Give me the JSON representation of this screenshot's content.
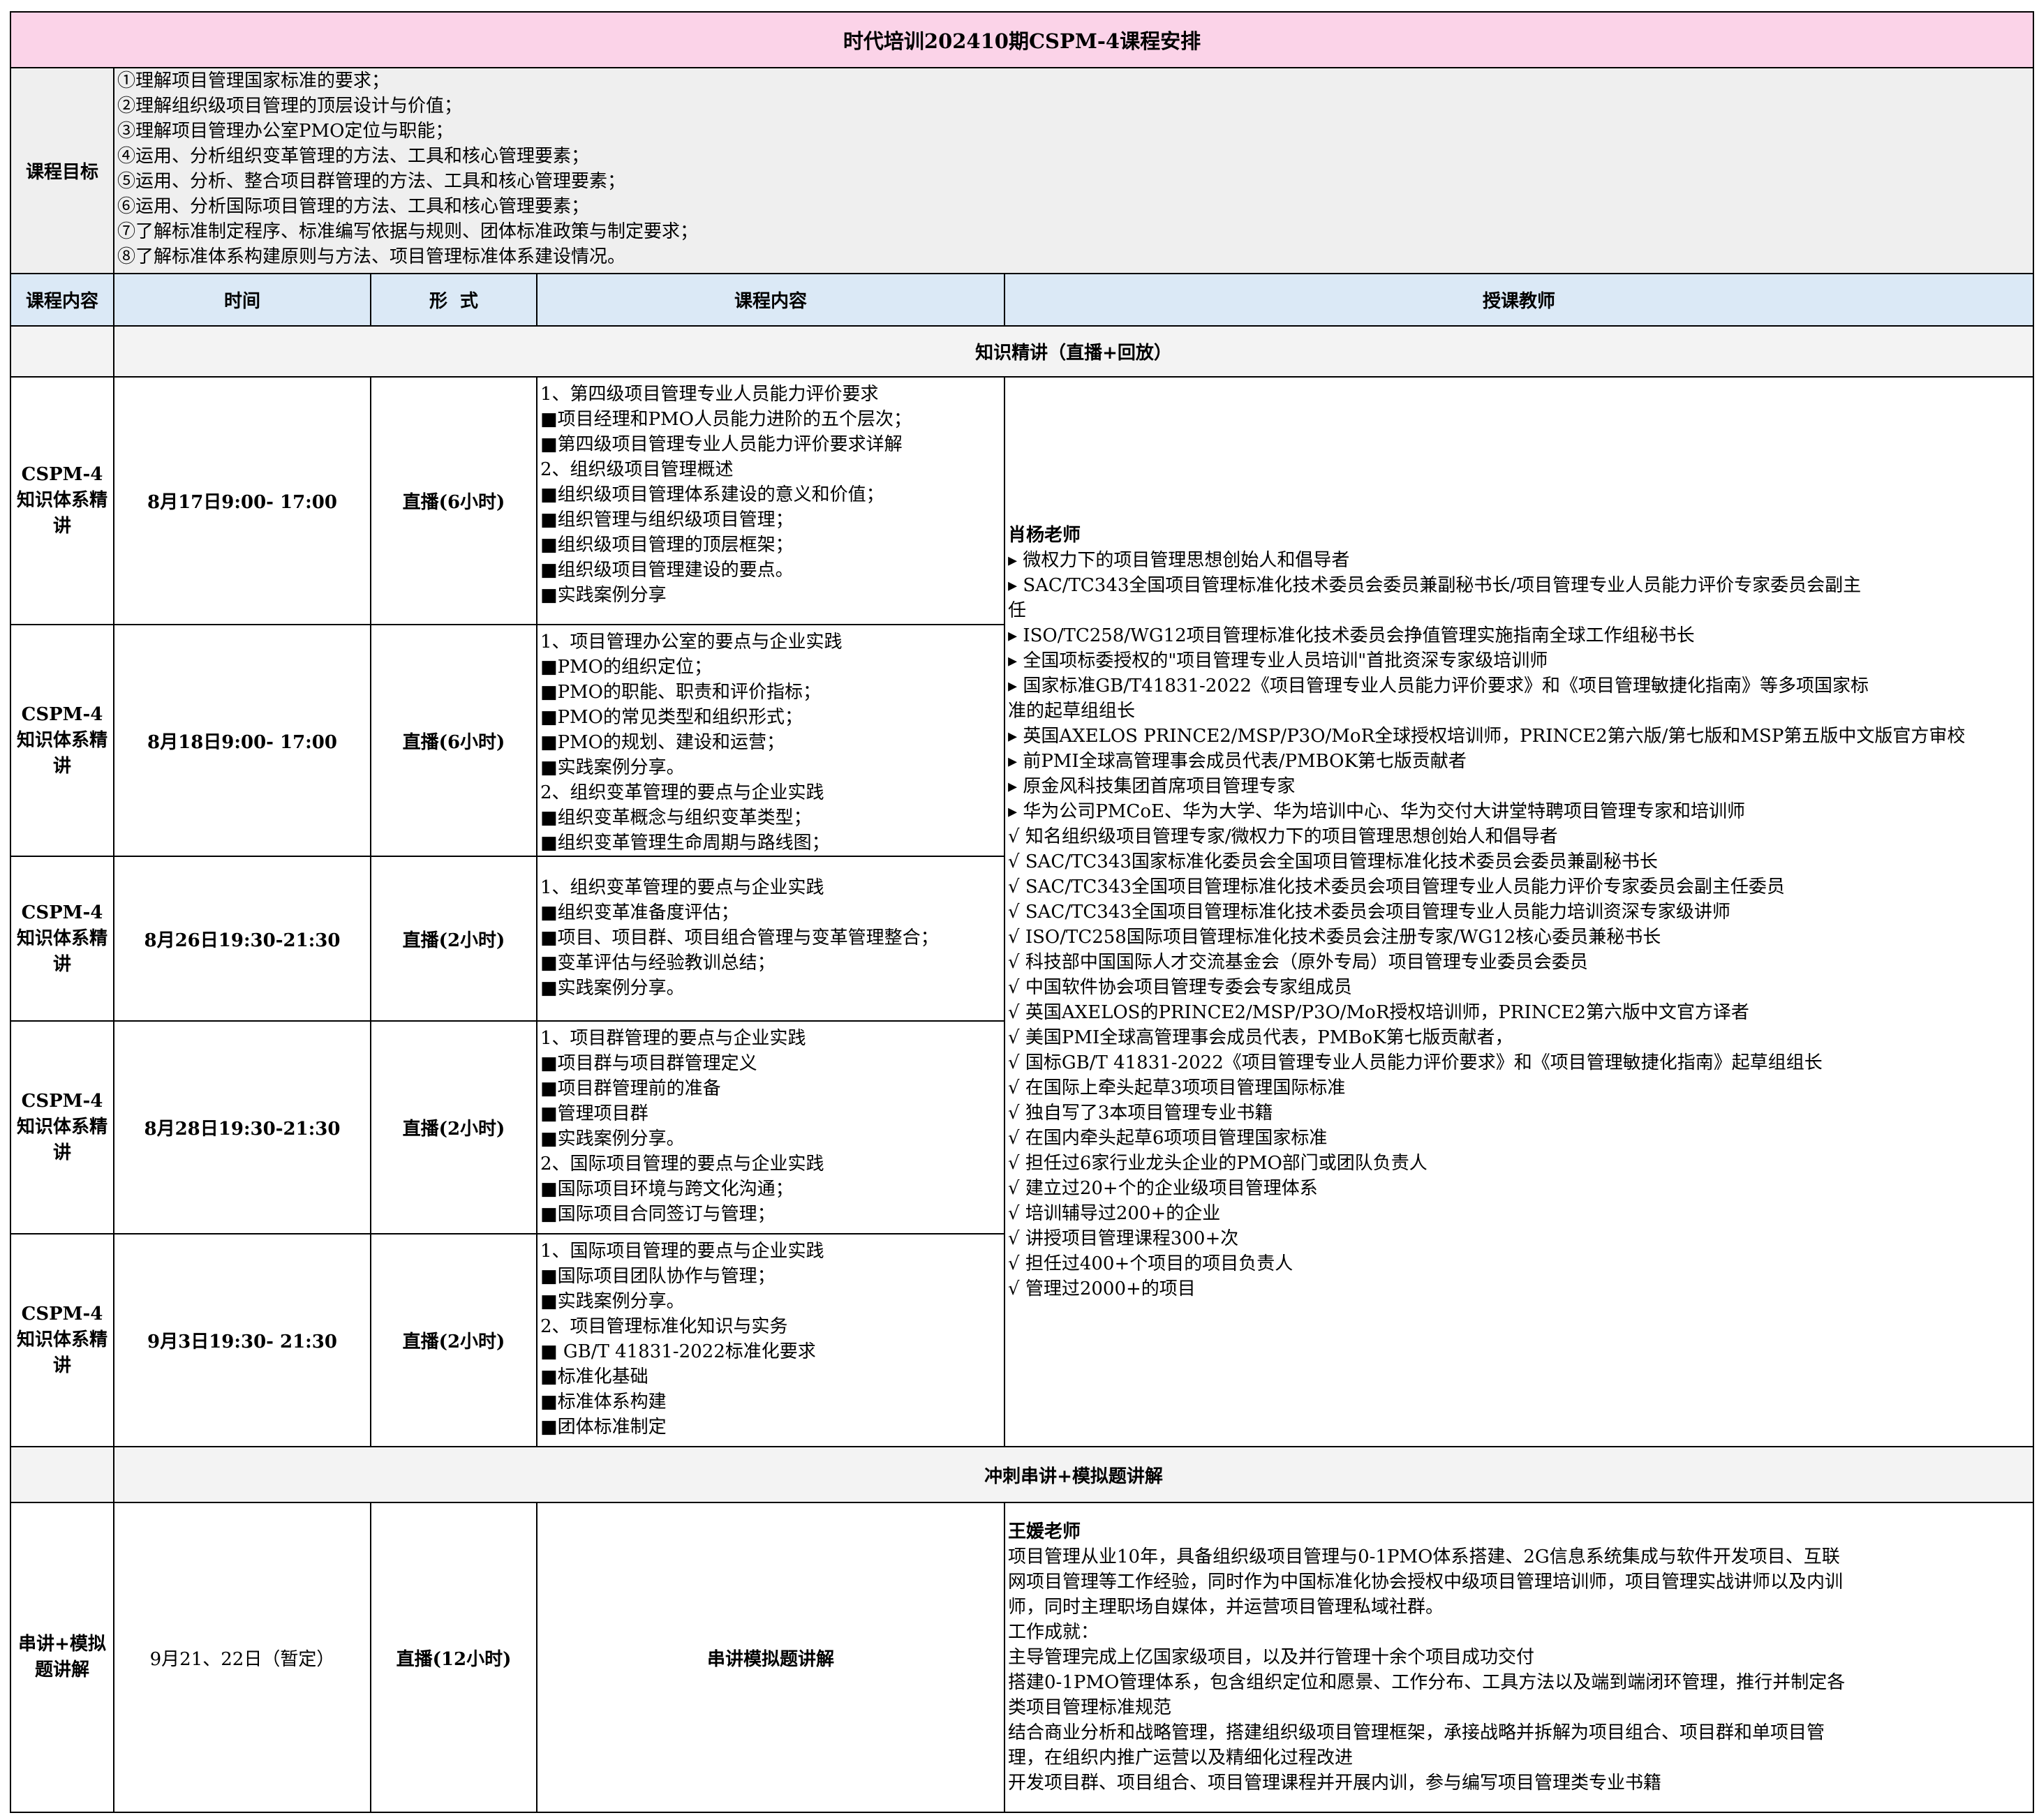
{
  "title": "时代培训202410期CSPM-4课程安排",
  "goals": {
    "label": "课程目标",
    "items": [
      "①理解项目管理国家标准的要求；",
      "②理解组织级项目管理的顶层设计与价值；",
      "③理解项目管理办公室PMO定位与职能；",
      "④运用、分析组织变革管理的方法、工具和核心管理要素；",
      "⑤运用、分析、整合项目群管理的方法、工具和核心管理要素；",
      "⑥运用、分析国际项目管理的方法、工具和核心管理要素；",
      "⑦了解标准制定程序、标准编写依据与规则、团体标准政策与制定要求；",
      "⑧了解标准体系构建原则与方法、项目管理标准体系建设情况。"
    ]
  },
  "headers": [
    "课程内容",
    "时间",
    "形  式",
    "课程内容",
    "授课教师"
  ],
  "section1": "知识精讲（直播+回放）",
  "sessions": [
    {
      "name": "CSPM-4知识体系精讲",
      "time": "8月17日9:00- 17:00",
      "form": "直播(6小时)",
      "content": [
        "1、第四级项目管理专业人员能力评价要求",
        "■项目经理和PMO人员能力进阶的五个层次；",
        "■第四级项目管理专业人员能力评价要求详解",
        "2、组织级项目管理概述",
        "■组织级项目管理体系建设的意义和价值；",
        "■组织管理与组织级项目管理；",
        "■组织级项目管理的顶层框架；",
        "■组织级项目管理建设的要点。",
        "■实践案例分享"
      ]
    },
    {
      "name": "CSPM-4知识体系精讲",
      "time": "8月18日9:00- 17:00",
      "form": "直播(6小时)",
      "content": [
        "1、项目管理办公室的要点与企业实践",
        "■PMO的组织定位；",
        "■PMO的职能、职责和评价指标；",
        "■PMO的常见类型和组织形式；",
        "■PMO的规划、建设和运营；",
        "■实践案例分享。",
        "2、组织变革管理的要点与企业实践",
        "■组织变革概念与组织变革类型；",
        "■组织变革管理生命周期与路线图；"
      ]
    },
    {
      "name": "CSPM-4知识体系精讲",
      "time": "8月26日19:30-21:30",
      "form": "直播(2小时)",
      "content": [
        "1、组织变革管理的要点与企业实践",
        "■组织变革准备度评估；",
        "■项目、项目群、项目组合管理与变革管理整合；",
        "■变革评估与经验教训总结；",
        "■实践案例分享。"
      ]
    },
    {
      "name": "CSPM-4知识体系精讲",
      "time": "8月28日19:30-21:30",
      "form": "直播(2小时)",
      "content": [
        "1、项目群管理的要点与企业实践",
        "■项目群与项目群管理定义",
        "■项目群管理前的准备",
        "■管理项目群",
        "■实践案例分享。",
        "2、国际项目管理的要点与企业实践",
        "■国际项目环境与跨文化沟通；",
        "■国际项目合同签订与管理；"
      ]
    },
    {
      "name": "CSPM-4知识体系精讲",
      "time": "9月3日19:30- 21:30",
      "form": "直播(2小时)",
      "content": [
        "1、国际项目管理的要点与企业实践",
        "■国际项目团队协作与管理；",
        "■实践案例分享。",
        "2、项目管理标准化知识与实务",
        "■ GB/T 41831-2022标准化要求",
        "■标准化基础",
        "■标准体系构建",
        "■团体标准制定"
      ]
    }
  ],
  "teacher1": {
    "name": "肖杨老师",
    "lines": [
      "▸  微权力下的项目管理思想创始人和倡导者",
      "▸  SAC/TC343全国项目管理标准化技术委员会委员兼副秘书长/项目管理专业人员能力评价专家委员会副主任",
      "▸  ISO/TC258/WG12项目管理标准化技术委员会挣值管理实施指南全球工作组秘书长",
      "▸  全国项标委授权的\"项目管理专业人员培训\"首批资深专家级培训师",
      "▸  国家标准GB/T41831-2022《项目管理专业人员能力评价要求》和《项目管理敏捷化指南》等多项国家标准的起草组组长",
      "▸  英国AXELOS PRINCE2/MSP/P3O/MoR全球授权培训师，PRINCE2第六版/第七版和MSP第五版中文版官方审校",
      "▸  前PMI全球高管理事会成员代表/PMBOK第七版贡献者",
      "▸  原金风科技集团首席项目管理专家",
      "▸  华为公司PMCoE、华为大学、华为培训中心、华为交付大讲堂特聘项目管理专家和培训师",
      "√  知名组织级项目管理专家/微权力下的项目管理思想创始人和倡导者",
      "√  SAC/TC343国家标准化委员会全国项目管理标准化技术委员会委员兼副秘书长",
      "√  SAC/TC343全国项目管理标准化技术委员会项目管理专业人员能力评价专家委员会副主任委员",
      "√  SAC/TC343全国项目管理标准化技术委员会项目管理专业人员能力培训资深专家级讲师",
      "√  ISO/TC258国际项目管理标准化技术委员会注册专家/WG12核心委员兼秘书长",
      "√  科技部中国国际人才交流基金会（原外专局）项目管理专业委员会委员",
      "√  中国软件协会项目管理专委会专家组成员",
      "√  英国AXELOS的PRINCE2/MSP/P3O/MoR授权培训师，PRINCE2第六版中文官方译者",
      "√  美国PMI全球高管理事会成员代表，PMBoK第七版贡献者，",
      "√  国标GB/T 41831-2022《项目管理专业人员能力评价要求》和《项目管理敏捷化指南》起草组组长",
      "√  在国际上牵头起草3项项目管理国际标准",
      "√  独自写了3本项目管理专业书籍",
      "√  在国内牵头起草6项项目管理国家标准",
      "√  担任过6家行业龙头企业的PMO部门或团队负责人",
      "√  建立过20+个的企业级项目管理体系",
      "√  培训辅导过200+的企业",
      "√  讲授项目管理课程300+次",
      "√  担任过400+个项目的项目负责人",
      "√  管理过2000+的项目"
    ]
  },
  "section2": "冲刺串讲+模拟题讲解",
  "final_session": {
    "name": "串讲+模拟题讲解",
    "time": "9月21、22日（暂定）",
    "form": "直播(12小时)",
    "content": "串讲模拟题讲解"
  },
  "teacher2": {
    "name": "王媛老师",
    "lines": [
      "项目管理从业10年，具备组织级项目管理与0-1PMO体系搭建、2G信息系统集成与软件开发项目、互联网项目管理等工作经验，同时作为中国标准化协会授权中级项目管理培训师，项目管理实战讲师以及内训师，同时主理职场自媒体，并运营项目管理私域社群。",
      "工作成就：",
      "主导管理完成上亿国家级项目，以及并行管理十余个项目成功交付",
      "搭建0-1PMO管理体系，包含组织定位和愿景、工作分布、工具方法以及端到端闭环管理，推行并制定各类项目管理标准规范",
      "结合商业分析和战略管理，搭建组织级项目管理框架，承接战略并拆解为项目组合、项目群和单项目管理，在组织内推广运营以及精细化过程改进",
      "开发项目群、项目组合、项目管理课程并开展内训，参与编写项目管理类专业书籍"
    ]
  }
}
